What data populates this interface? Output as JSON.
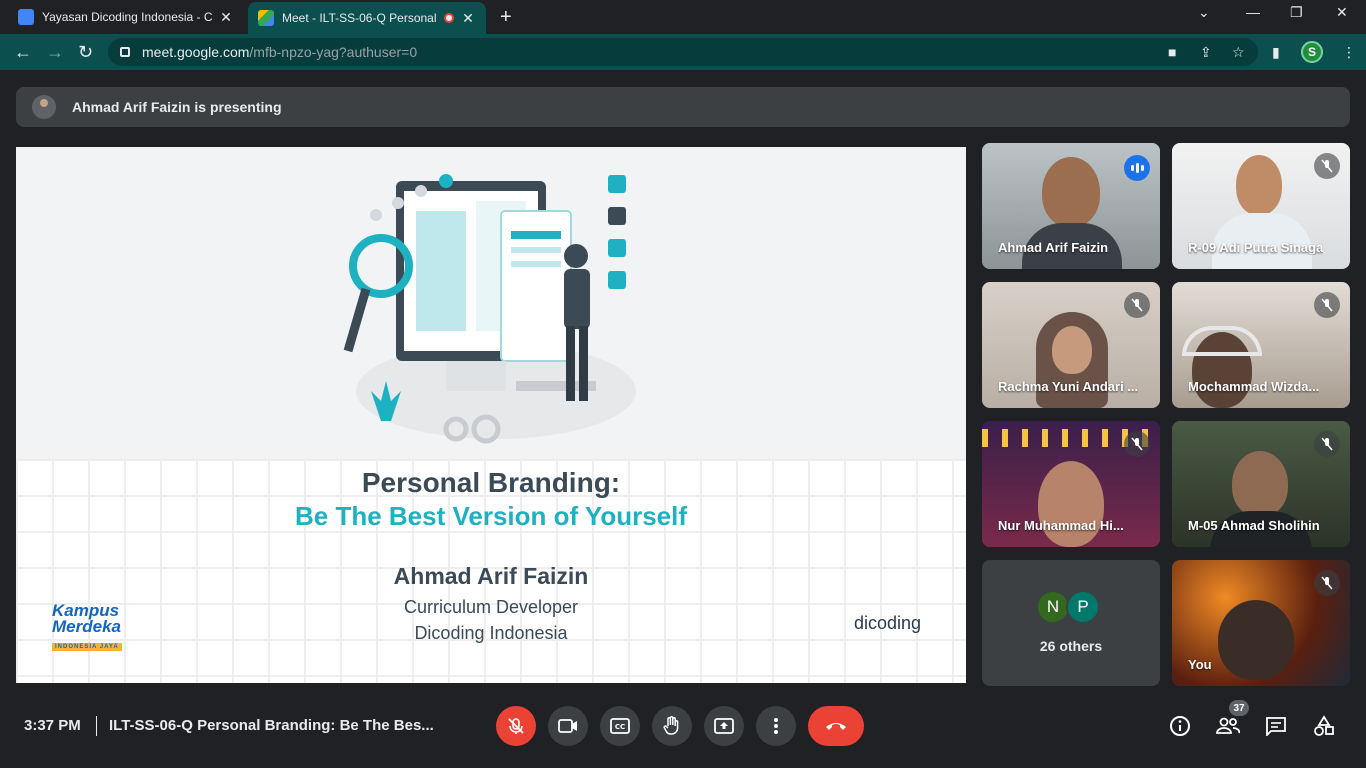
{
  "browser": {
    "tabs": [
      {
        "title": "Yayasan Dicoding Indonesia - Cal",
        "active": false
      },
      {
        "title": "Meet - ILT-SS-06-Q Personal",
        "active": true
      }
    ],
    "url_host": "meet.google.com",
    "url_path": "/mfb-npzo-yag?authuser=0",
    "profile_initial": "S"
  },
  "banner": {
    "text": "Ahmad Arif Faizin is presenting"
  },
  "slide": {
    "title": "Personal Branding:",
    "subtitle": "Be The Best Version of Yourself",
    "presenter": "Ahmad Arif Faizin",
    "role": "Curriculum Developer",
    "org": "Dicoding Indonesia",
    "logo_left_l1": "Kampus",
    "logo_left_l2": "Merdeka",
    "logo_left_l3": "INDONESIA JAYA",
    "logo_right": "dicoding"
  },
  "participants": [
    {
      "name": "Ahmad Arif Faizin",
      "speaking": true
    },
    {
      "name": "R-09 Adi Putra Sinaga",
      "muted": true
    },
    {
      "name": "Rachma Yuni Andari ...",
      "muted": true
    },
    {
      "name": "Mochammad Wizda...",
      "muted": true
    },
    {
      "name": "Nur Muhammad Hi...",
      "muted": true
    },
    {
      "name": "M-05 Ahmad Sholihin",
      "muted": true
    },
    {
      "name": "You",
      "muted": true
    }
  ],
  "others": {
    "initials": [
      "N",
      "P"
    ],
    "label": "26 others"
  },
  "bottom": {
    "time": "3:37 PM",
    "meeting_title": "ILT-SS-06-Q Personal Branding: Be The Bes...",
    "people_count": "37"
  },
  "colors": {
    "accent_teal": "#0b4f4f",
    "end_call": "#ea4335",
    "speaker": "#1a73e8"
  }
}
